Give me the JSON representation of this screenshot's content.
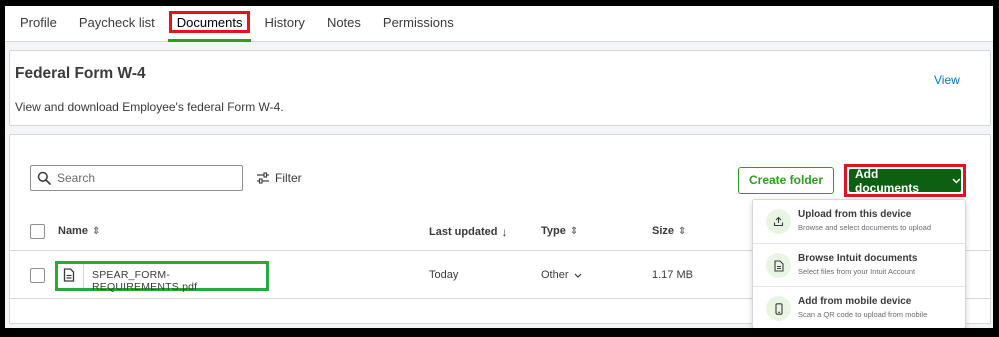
{
  "tabs": [
    {
      "label": "Profile",
      "active": false
    },
    {
      "label": "Paycheck list",
      "active": false
    },
    {
      "label": "Documents",
      "active": true
    },
    {
      "label": "History",
      "active": false
    },
    {
      "label": "Notes",
      "active": false
    },
    {
      "label": "Permissions",
      "active": false
    }
  ],
  "w4_card": {
    "title": "Federal Form W-4",
    "description": "View and download Employee's federal Form W-4.",
    "view_label": "View"
  },
  "toolbar": {
    "search_placeholder": "Search",
    "filter_label": "Filter",
    "create_folder_label": "Create folder",
    "add_documents_label": "Add documents"
  },
  "table": {
    "headers": {
      "name": "Name",
      "last_updated": "Last updated",
      "type": "Type",
      "size": "Size"
    },
    "rows": [
      {
        "name": "SPEAR_FORM-REQUIREMENTS.pdf",
        "last_updated": "Today",
        "type": "Other",
        "size": "1.17 MB"
      }
    ]
  },
  "add_menu": [
    {
      "title": "Upload from this device",
      "subtitle": "Browse and select documents to upload",
      "icon": "upload-icon"
    },
    {
      "title": "Browse Intuit documents",
      "subtitle": "Select files from your Intuit Account",
      "icon": "document-icon"
    },
    {
      "title": "Add from mobile device",
      "subtitle": "Scan a QR code to upload from mobile",
      "icon": "mobile-icon"
    }
  ],
  "colors": {
    "accent_green": "#2ca01c",
    "dark_green_button": "#0d5f12",
    "highlight_red": "#e0141e",
    "highlight_green": "#2ba83a",
    "link_blue": "#0077c5"
  }
}
